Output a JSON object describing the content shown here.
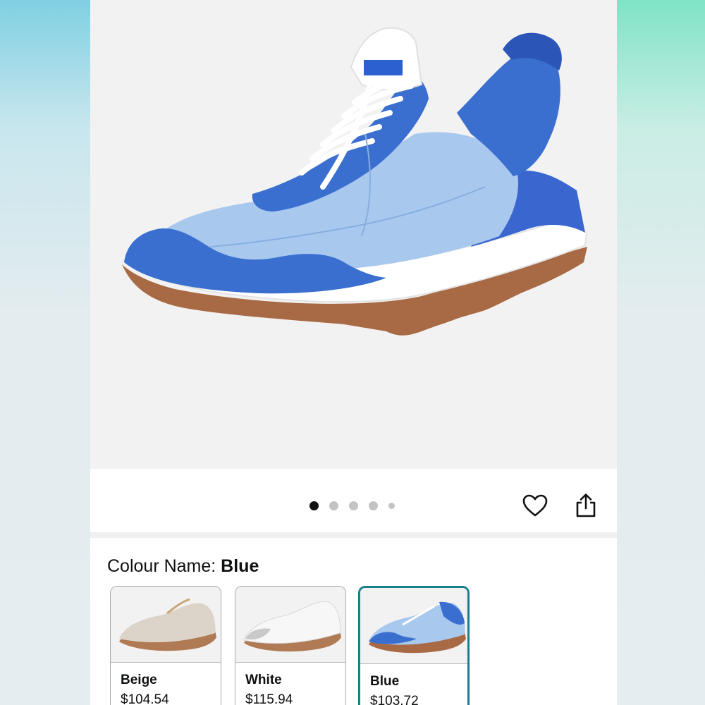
{
  "gallery": {
    "dot_count": 5,
    "active_index": 0
  },
  "variants": {
    "label": "Colour Name: ",
    "selected_value": "Blue",
    "options": [
      {
        "name": "Beige",
        "price": "$104.54",
        "color": "#d9d2c8"
      },
      {
        "name": "White",
        "price": "$115.94",
        "color": "#f4f4f4"
      },
      {
        "name": "Blue",
        "price": "$103.72",
        "color": "#3a6fd0"
      }
    ]
  },
  "icons": {
    "wishlist": "heart-icon",
    "share": "share-icon"
  },
  "colors": {
    "selected_border": "#1a7f8c",
    "shoe_blue": "#3a6fd0",
    "shoe_light_blue": "#a8c8ee"
  }
}
